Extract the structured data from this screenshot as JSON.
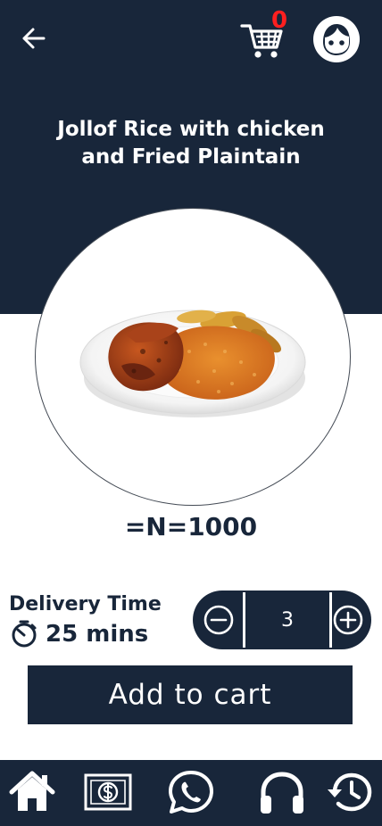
{
  "header": {
    "back_icon": "arrow-left-icon",
    "cart_icon": "shopping-cart-icon",
    "cart_count": "0",
    "profile_icon": "face-avatar-icon"
  },
  "product": {
    "title": "Jollof Rice with chicken and Fried Plaintain",
    "price": "=N=1000",
    "image": "plate of jollof rice with chicken and fried plantain"
  },
  "delivery": {
    "label": "Delivery Time",
    "time": "25 mins",
    "icon": "timer-icon"
  },
  "quantity": {
    "value": "3",
    "minus_icon": "minus-circle-icon",
    "plus_icon": "plus-circle-icon"
  },
  "actions": {
    "add_to_cart": "Add to cart"
  },
  "bottom_nav": {
    "items": [
      {
        "icon": "home-icon"
      },
      {
        "icon": "money-icon"
      },
      {
        "icon": "whatsapp-icon"
      },
      {
        "icon": "headphones-icon"
      },
      {
        "icon": "history-icon"
      }
    ]
  },
  "colors": {
    "navy": "#18263a",
    "badge_red": "#ff1f1f",
    "white": "#ffffff"
  }
}
